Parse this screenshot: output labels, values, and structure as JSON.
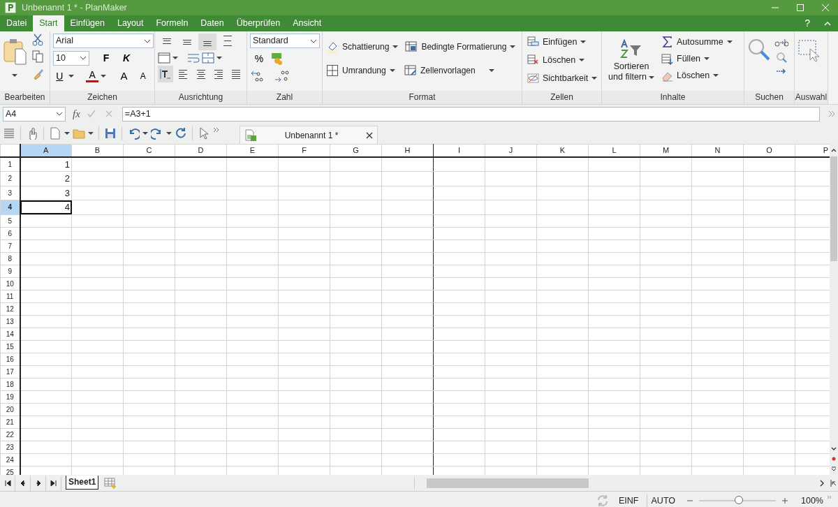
{
  "window": {
    "title": "Unbenannt 1 * - PlanMaker",
    "help": "?"
  },
  "ribbon_tabs": [
    {
      "label": "Datei",
      "selected": false
    },
    {
      "label": "Start",
      "selected": true
    },
    {
      "label": "Einfügen",
      "selected": false
    },
    {
      "label": "Layout",
      "selected": false
    },
    {
      "label": "Formeln",
      "selected": false
    },
    {
      "label": "Daten",
      "selected": false
    },
    {
      "label": "Überprüfen",
      "selected": false
    },
    {
      "label": "Ansicht",
      "selected": false
    }
  ],
  "ribbon": {
    "font_name": "Arial",
    "font_size": "10",
    "style_buttons": [
      {
        "label": "F",
        "kind": "bold"
      },
      {
        "label": "K",
        "kind": "italic"
      },
      {
        "label": "U",
        "kind": "underline"
      },
      {
        "label": "A",
        "kind": "color"
      },
      {
        "label": "A",
        "kind": "grow"
      },
      {
        "label": "A",
        "kind": "shrink"
      }
    ],
    "alignment_top": [
      {
        "kind": "top",
        "selected": false
      },
      {
        "kind": "middle",
        "selected": false
      },
      {
        "kind": "bottom",
        "selected": true
      },
      {
        "kind": "distributed",
        "selected": false
      }
    ],
    "alignment_bottom": [
      {
        "kind": "orientation",
        "selected": true
      },
      {
        "kind": "left",
        "selected": false
      },
      {
        "kind": "center",
        "selected": false
      },
      {
        "kind": "right",
        "selected": false
      },
      {
        "kind": "justify",
        "selected": false
      }
    ],
    "number_format": "Standard",
    "percent": "%",
    "format_buttons": [
      {
        "label": "Schattierung",
        "kind": "shading"
      },
      {
        "label": "Bedingte Formatierung",
        "kind": "conditional"
      },
      {
        "label": "Umrandung",
        "kind": "border"
      },
      {
        "label": "Zellenvorlagen",
        "kind": "styles"
      }
    ],
    "cell_buttons": [
      {
        "label": "Einfügen",
        "kind": "insert"
      },
      {
        "label": "Löschen",
        "kind": "delete"
      },
      {
        "label": "Sichtbarkeit",
        "kind": "visibility"
      }
    ],
    "sort_button": "Sortieren und filtern",
    "content_buttons": [
      {
        "label": "Autosumme",
        "kind": "sum"
      },
      {
        "label": "Füllen",
        "kind": "fill"
      },
      {
        "label": "Löschen",
        "kind": "erase"
      }
    ],
    "group_labels": [
      "Bearbeiten",
      "Zeichen",
      "Ausrichtung",
      "Zahl",
      "Format",
      "Zellen",
      "Inhalte",
      "Suchen",
      "Auswahl"
    ]
  },
  "formula_bar": {
    "cell_ref": "A4",
    "function_label": "fx",
    "formula": "=A3+1"
  },
  "document_tab": {
    "title": "Unbenannt 1 *"
  },
  "columns": [
    {
      "label": "A",
      "selected": true
    },
    {
      "label": "B",
      "selected": false
    },
    {
      "label": "C",
      "selected": false
    },
    {
      "label": "D",
      "selected": false
    },
    {
      "label": "E",
      "selected": false
    },
    {
      "label": "F",
      "selected": false
    },
    {
      "label": "G",
      "selected": false
    },
    {
      "label": "H",
      "selected": false,
      "page_break": true
    },
    {
      "label": "I",
      "selected": false
    },
    {
      "label": "J",
      "selected": false
    },
    {
      "label": "K",
      "selected": false
    },
    {
      "label": "L",
      "selected": false
    },
    {
      "label": "M",
      "selected": false
    },
    {
      "label": "N",
      "selected": false
    },
    {
      "label": "O",
      "selected": false
    },
    {
      "label": "P",
      "selected": false
    }
  ],
  "rows": [
    {
      "label": "1",
      "selected": false,
      "cells": [
        {
          "value": "1",
          "active": false
        }
      ]
    },
    {
      "label": "2",
      "selected": false,
      "cells": [
        {
          "value": "2",
          "active": false
        }
      ]
    },
    {
      "label": "3",
      "selected": false,
      "cells": [
        {
          "value": "3",
          "active": false
        }
      ]
    },
    {
      "label": "4",
      "selected": true,
      "cells": [
        {
          "value": "4",
          "active": true
        }
      ]
    },
    {
      "label": "5",
      "selected": false
    },
    {
      "label": "6",
      "selected": false
    },
    {
      "label": "7",
      "selected": false
    },
    {
      "label": "8",
      "selected": false
    },
    {
      "label": "9",
      "selected": false
    },
    {
      "label": "10",
      "selected": false
    },
    {
      "label": "11",
      "selected": false
    },
    {
      "label": "12",
      "selected": false
    },
    {
      "label": "13",
      "selected": false
    },
    {
      "label": "14",
      "selected": false
    },
    {
      "label": "15",
      "selected": false
    },
    {
      "label": "16",
      "selected": false
    },
    {
      "label": "17",
      "selected": false
    },
    {
      "label": "18",
      "selected": false
    },
    {
      "label": "19",
      "selected": false
    },
    {
      "label": "20",
      "selected": false
    },
    {
      "label": "21",
      "selected": false
    },
    {
      "label": "22",
      "selected": false
    },
    {
      "label": "23",
      "selected": false
    },
    {
      "label": "24",
      "selected": false
    },
    {
      "label": "25",
      "selected": false
    }
  ],
  "sheet_tabs": [
    {
      "label": "Sheet1",
      "selected": true
    }
  ],
  "status_bar": {
    "insert_mode": "EINF",
    "calc_mode": "AUTO",
    "zoom": {
      "level": 0.52,
      "reading": "100%"
    }
  }
}
